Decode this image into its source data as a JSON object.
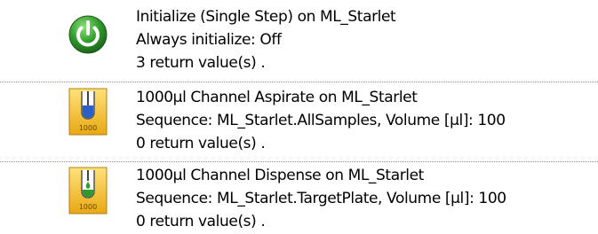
{
  "steps": [
    {
      "icon": "initialize-power-icon",
      "title": "Initialize (Single Step) on ML_Starlet",
      "detail": "Always initialize: Off",
      "returns": "3 return value(s) ."
    },
    {
      "icon": "channel-aspirate-icon",
      "icon_label": "1000",
      "title": "1000µl Channel Aspirate on ML_Starlet",
      "detail": "Sequence: ML_Starlet.AllSamples, Volume [µl]: 100",
      "returns": "0 return value(s) ."
    },
    {
      "icon": "channel-dispense-icon",
      "icon_label": "1000",
      "title": "1000µl Channel Dispense on ML_Starlet",
      "detail": "Sequence: ML_Starlet.TargetPlate, Volume [µl]: 100",
      "returns": "0 return value(s) ."
    }
  ],
  "colors": {
    "power_green": "#2e9a2a",
    "tile_yellow": "#f6c32a",
    "aspirate_blue": "#2a5fc8",
    "dispense_green": "#2d9b2d",
    "separator": "#8a8a8a"
  }
}
